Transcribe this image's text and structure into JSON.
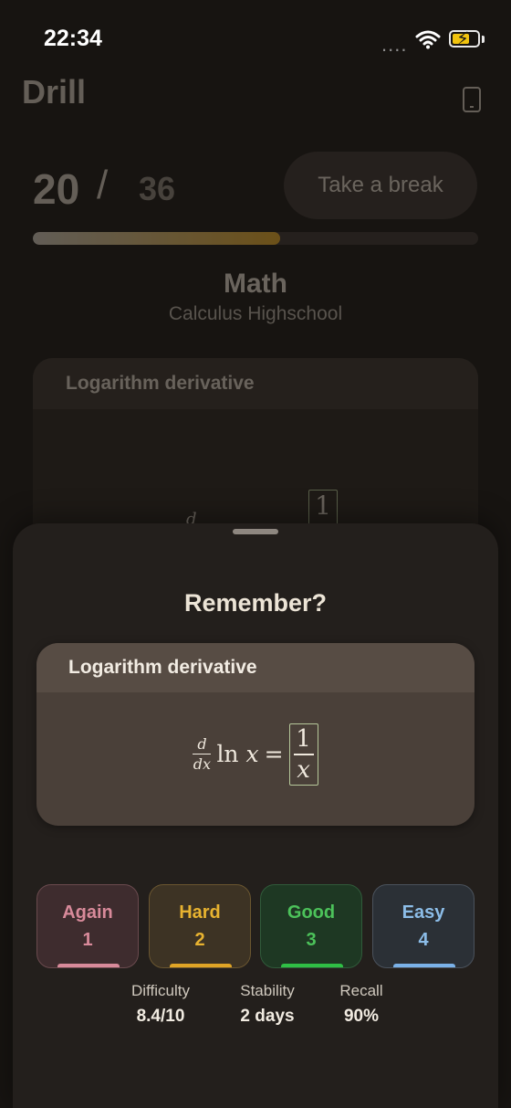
{
  "status_bar": {
    "time": "22:34",
    "signal": "....",
    "charging": "⚡"
  },
  "header": {
    "title": "Drill"
  },
  "progress": {
    "current": "20",
    "separator": "/",
    "total": "36",
    "fraction": 0.556
  },
  "break_button": {
    "label": "Take a break"
  },
  "deck": {
    "name": "Math",
    "subtitle": "Calculus Highschool"
  },
  "background_card": {
    "title": "Logarithm derivative",
    "fragment_d": "d",
    "fragment_box": "1"
  },
  "sheet": {
    "title": "Remember?",
    "card": {
      "title": "Logarithm derivative",
      "formula": {
        "frac_num": "d",
        "frac_den": "dx",
        "ln": "ln",
        "var": "x",
        "equals": "=",
        "ans_num": "1",
        "ans_den": "x"
      }
    },
    "ratings": [
      {
        "label": "Again",
        "key": "1",
        "color": "#d88a9a"
      },
      {
        "label": "Hard",
        "key": "2",
        "color": "#e8b330"
      },
      {
        "label": "Good",
        "key": "3",
        "color": "#4cc25a"
      },
      {
        "label": "Easy",
        "key": "4",
        "color": "#8cbde8"
      }
    ],
    "stats": [
      {
        "label": "Difficulty",
        "value": "8.4/10"
      },
      {
        "label": "Stability",
        "value": "2 days"
      },
      {
        "label": "Recall",
        "value": "90%"
      }
    ]
  }
}
